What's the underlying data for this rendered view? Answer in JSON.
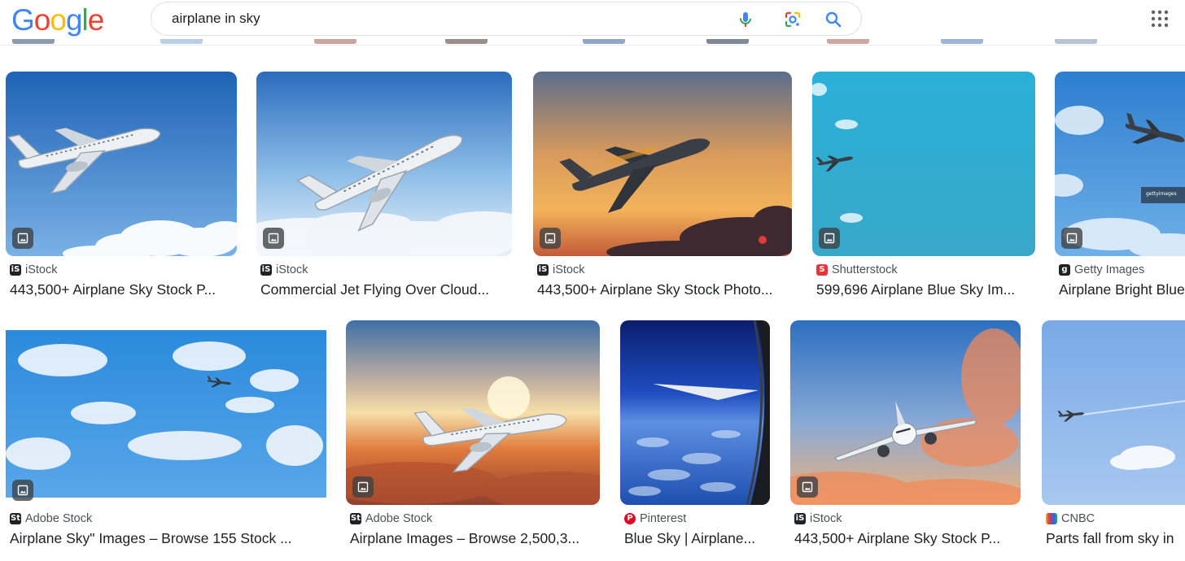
{
  "header": {
    "logo": [
      "G",
      "o",
      "o",
      "g",
      "l",
      "e"
    ],
    "logo_colors": [
      "#4285F4",
      "#EA4335",
      "#FBBC05",
      "#4285F4",
      "#34A853",
      "#EA4335"
    ],
    "query": "airplane in sky",
    "icons": [
      "voice-search-icon",
      "lens-icon",
      "search-icon",
      "apps-grid-icon"
    ]
  },
  "results": [
    {
      "source": "iStock",
      "favicon": "istock",
      "title": "443,500+ Airplane Sky Stock P..."
    },
    {
      "source": "iStock",
      "favicon": "istock",
      "title": "Commercial Jet Flying Over Cloud..."
    },
    {
      "source": "iStock",
      "favicon": "istock",
      "title": "443,500+ Airplane Sky Stock Photo..."
    },
    {
      "source": "Shutterstock",
      "favicon": "shutterstock",
      "title": "599,696 Airplane Blue Sky Im..."
    },
    {
      "source": "Getty Images",
      "favicon": "getty",
      "title": "Airplane Bright Blue"
    },
    {
      "source": "Adobe Stock",
      "favicon": "adobe",
      "title": "Airplane Sky\" Images – Browse 155 Stock ..."
    },
    {
      "source": "Adobe Stock",
      "favicon": "adobe",
      "title": "Airplane Images – Browse 2,500,3..."
    },
    {
      "source": "Pinterest",
      "favicon": "pinterest",
      "title": "Blue Sky | Airplane..."
    },
    {
      "source": "iStock",
      "favicon": "istock",
      "title": "443,500+ Airplane Sky Stock P..."
    },
    {
      "source": "CNBC",
      "favicon": "cnbc",
      "title": "Parts fall from sky in"
    }
  ],
  "image_watermark": "gettyimages"
}
